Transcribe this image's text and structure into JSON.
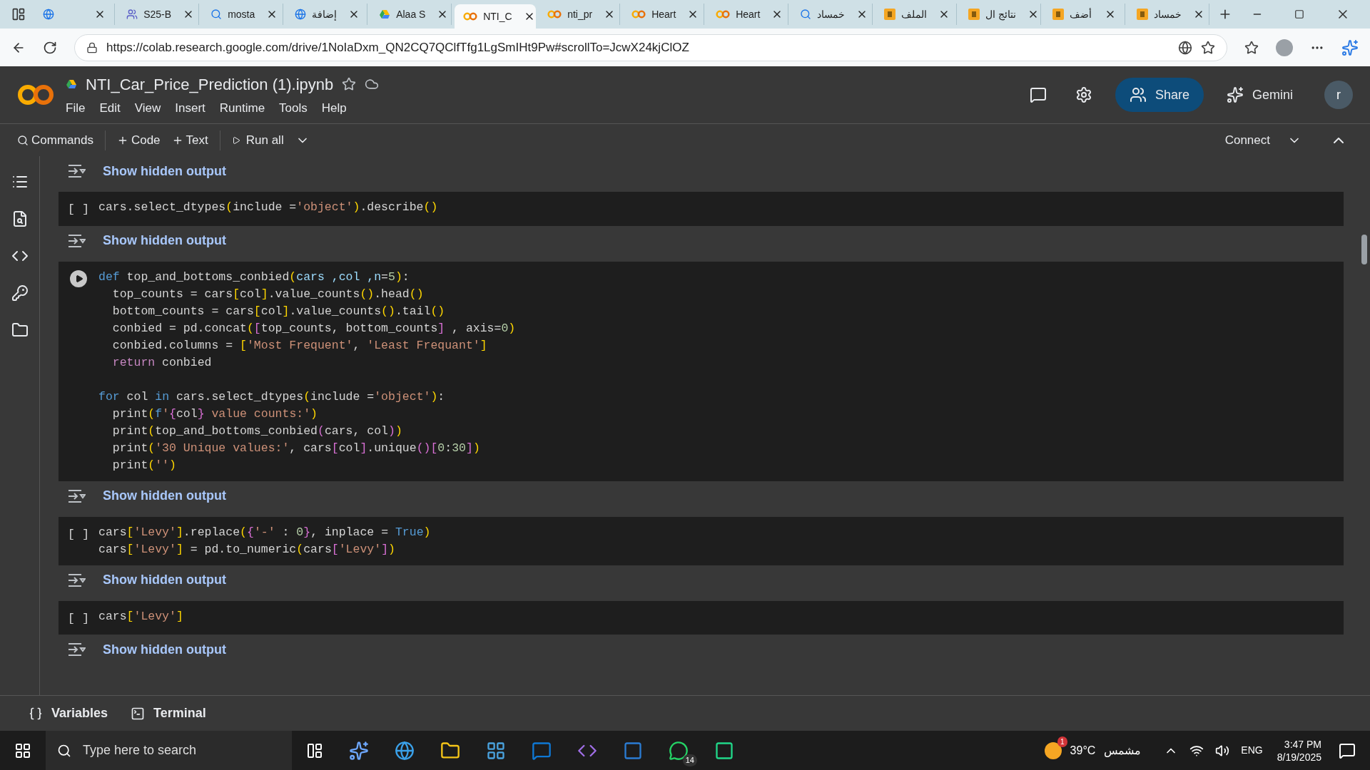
{
  "browser": {
    "tabs": [
      {
        "selected": false
      },
      {
        "title": "S25-B",
        "selected": false
      },
      {
        "title": "mosta",
        "selected": false
      },
      {
        "title": "إضافة",
        "selected": false
      },
      {
        "title": "Alaa S",
        "selected": false
      },
      {
        "title": "NTI_C",
        "selected": true
      },
      {
        "title": "nti_pr",
        "selected": false
      },
      {
        "title": "Heart",
        "selected": false
      },
      {
        "title": "Heart",
        "selected": false
      },
      {
        "title": "خمساد",
        "selected": false
      },
      {
        "title": "الملف",
        "selected": false
      },
      {
        "title": "نتائج ال",
        "selected": false
      },
      {
        "title": "أضف",
        "selected": false
      },
      {
        "title": "خمساد",
        "selected": false
      }
    ],
    "url": "https://colab.research.google.com/drive/1NoIaDxm_QN2CQ7QClfTfg1LgSmIHt9Pw#scrollTo=JcwX24kjClOZ"
  },
  "notebook": {
    "title": "NTI_Car_Price_Prediction (1).ipynb",
    "menu": [
      "File",
      "Edit",
      "View",
      "Insert",
      "Runtime",
      "Tools",
      "Help"
    ],
    "share": "Share",
    "gemini": "Gemini",
    "avatar": "r"
  },
  "toolbar": {
    "commands": "Commands",
    "add_code": "Code",
    "add_text": "Text",
    "run_all": "Run all",
    "connect": "Connect"
  },
  "cells": [
    {
      "kind": "output",
      "label": "Show hidden output"
    },
    {
      "kind": "code",
      "hovered": false,
      "prompt": "[ ]",
      "blocks": [
        [
          [
            {
              "kind": "p",
              "text": "cars.select_dtypes"
            },
            {
              "kind": "b1",
              "text": "("
            },
            {
              "kind": "p",
              "text": "include ="
            },
            {
              "kind": "s",
              "text": "'object'"
            },
            {
              "kind": "b1",
              "text": ")"
            },
            {
              "kind": "p",
              "text": ".describe"
            },
            {
              "kind": "b1",
              "text": "()"
            }
          ]
        ]
      ]
    },
    {
      "kind": "output",
      "label": "Show hidden output"
    },
    {
      "kind": "code",
      "hovered": true,
      "blocks": [
        [
          [
            {
              "kind": "k",
              "text": "def"
            },
            {
              "kind": "p",
              "text": " top_and_bottoms_conbied"
            },
            {
              "kind": "b1",
              "text": "("
            },
            {
              "kind": "v",
              "text": "cars ,col ,n"
            },
            {
              "kind": "p",
              "text": "="
            },
            {
              "kind": "n",
              "text": "5"
            },
            {
              "kind": "b1",
              "text": ")"
            },
            {
              "kind": "p",
              "text": ":"
            }
          ],
          [
            {
              "kind": "p",
              "text": "  top_counts = cars"
            },
            {
              "kind": "b1",
              "text": "["
            },
            {
              "kind": "p",
              "text": "col"
            },
            {
              "kind": "b1",
              "text": "]"
            },
            {
              "kind": "p",
              "text": ".value_counts"
            },
            {
              "kind": "b1",
              "text": "()"
            },
            {
              "kind": "p",
              "text": ".head"
            },
            {
              "kind": "b1",
              "text": "()"
            }
          ],
          [
            {
              "kind": "p",
              "text": "  bottom_counts = cars"
            },
            {
              "kind": "b1",
              "text": "["
            },
            {
              "kind": "p",
              "text": "col"
            },
            {
              "kind": "b1",
              "text": "]"
            },
            {
              "kind": "p",
              "text": ".value_counts"
            },
            {
              "kind": "b1",
              "text": "()"
            },
            {
              "kind": "p",
              "text": ".tail"
            },
            {
              "kind": "b1",
              "text": "()"
            }
          ],
          [
            {
              "kind": "p",
              "text": "  conbied = pd.concat"
            },
            {
              "kind": "b1",
              "text": "("
            },
            {
              "kind": "b2",
              "text": "["
            },
            {
              "kind": "p",
              "text": "top_counts, bottom_counts"
            },
            {
              "kind": "b2",
              "text": "]"
            },
            {
              "kind": "p",
              "text": " , axis="
            },
            {
              "kind": "n",
              "text": "0"
            },
            {
              "kind": "b1",
              "text": ")"
            }
          ],
          [
            {
              "kind": "p",
              "text": "  conbied.columns = "
            },
            {
              "kind": "b1",
              "text": "["
            },
            {
              "kind": "s",
              "text": "'Most Frequent'"
            },
            {
              "kind": "p",
              "text": ", "
            },
            {
              "kind": "s",
              "text": "'Least Frequant'"
            },
            {
              "kind": "b1",
              "text": "]"
            }
          ],
          [
            {
              "kind": "c",
              "text": "  return"
            },
            {
              "kind": "p",
              "text": " conbied"
            }
          ]
        ],
        [
          [
            {
              "kind": "k",
              "text": "for"
            },
            {
              "kind": "p",
              "text": " col "
            },
            {
              "kind": "k",
              "text": "in"
            },
            {
              "kind": "p",
              "text": " cars.select_dtypes"
            },
            {
              "kind": "b1",
              "text": "("
            },
            {
              "kind": "p",
              "text": "include ="
            },
            {
              "kind": "s",
              "text": "'object'"
            },
            {
              "kind": "b1",
              "text": ")"
            },
            {
              "kind": "p",
              "text": ":"
            }
          ],
          [
            {
              "kind": "p",
              "text": "  print"
            },
            {
              "kind": "b1",
              "text": "("
            },
            {
              "kind": "k",
              "text": "f"
            },
            {
              "kind": "s",
              "text": "'"
            },
            {
              "kind": "b2",
              "text": "{"
            },
            {
              "kind": "p",
              "text": "col"
            },
            {
              "kind": "b2",
              "text": "}"
            },
            {
              "kind": "s",
              "text": " value counts:'"
            },
            {
              "kind": "b1",
              "text": ")"
            }
          ],
          [
            {
              "kind": "p",
              "text": "  print"
            },
            {
              "kind": "b1",
              "text": "("
            },
            {
              "kind": "p",
              "text": "top_and_bottoms_conbied"
            },
            {
              "kind": "b2",
              "text": "("
            },
            {
              "kind": "p",
              "text": "cars, col"
            },
            {
              "kind": "b2",
              "text": ")"
            },
            {
              "kind": "b1",
              "text": ")"
            }
          ],
          [
            {
              "kind": "p",
              "text": "  print"
            },
            {
              "kind": "b1",
              "text": "("
            },
            {
              "kind": "s",
              "text": "'30 Unique values:'"
            },
            {
              "kind": "p",
              "text": ", cars"
            },
            {
              "kind": "b2",
              "text": "["
            },
            {
              "kind": "p",
              "text": "col"
            },
            {
              "kind": "b2",
              "text": "]"
            },
            {
              "kind": "p",
              "text": ".unique"
            },
            {
              "kind": "b2",
              "text": "()"
            },
            {
              "kind": "b2",
              "text": "["
            },
            {
              "kind": "n",
              "text": "0"
            },
            {
              "kind": "p",
              "text": ":"
            },
            {
              "kind": "n",
              "text": "30"
            },
            {
              "kind": "b2",
              "text": "]"
            },
            {
              "kind": "b1",
              "text": ")"
            }
          ],
          [
            {
              "kind": "p",
              "text": "  print"
            },
            {
              "kind": "b1",
              "text": "("
            },
            {
              "kind": "s",
              "text": "''"
            },
            {
              "kind": "b1",
              "text": ")"
            }
          ]
        ]
      ]
    },
    {
      "kind": "output",
      "label": "Show hidden output"
    },
    {
      "kind": "code",
      "hovered": false,
      "prompt": "[ ]",
      "blocks": [
        [
          [
            {
              "kind": "p",
              "text": "cars"
            },
            {
              "kind": "b1",
              "text": "["
            },
            {
              "kind": "s",
              "text": "'Levy'"
            },
            {
              "kind": "b1",
              "text": "]"
            },
            {
              "kind": "p",
              "text": ".replace"
            },
            {
              "kind": "b1",
              "text": "("
            },
            {
              "kind": "b2",
              "text": "{"
            },
            {
              "kind": "s",
              "text": "'-'"
            },
            {
              "kind": "p",
              "text": " : "
            },
            {
              "kind": "n",
              "text": "0"
            },
            {
              "kind": "b2",
              "text": "}"
            },
            {
              "kind": "p",
              "text": ", inplace = "
            },
            {
              "kind": "k",
              "text": "True"
            },
            {
              "kind": "b1",
              "text": ")"
            }
          ],
          [
            {
              "kind": "p",
              "text": "cars"
            },
            {
              "kind": "b1",
              "text": "["
            },
            {
              "kind": "s",
              "text": "'Levy'"
            },
            {
              "kind": "b1",
              "text": "]"
            },
            {
              "kind": "p",
              "text": " = pd.to_numeric"
            },
            {
              "kind": "b1",
              "text": "("
            },
            {
              "kind": "p",
              "text": "cars"
            },
            {
              "kind": "b2",
              "text": "["
            },
            {
              "kind": "s",
              "text": "'Levy'"
            },
            {
              "kind": "b2",
              "text": "]"
            },
            {
              "kind": "b1",
              "text": ")"
            }
          ]
        ]
      ]
    },
    {
      "kind": "output",
      "label": "Show hidden output"
    },
    {
      "kind": "code",
      "hovered": false,
      "prompt": "[ ]",
      "blocks": [
        [
          [
            {
              "kind": "p",
              "text": "cars"
            },
            {
              "kind": "b1",
              "text": "["
            },
            {
              "kind": "s",
              "text": "'Levy'"
            },
            {
              "kind": "b1",
              "text": "]"
            }
          ]
        ]
      ]
    },
    {
      "kind": "output",
      "label": "Show hidden output"
    }
  ],
  "bottom_bar": {
    "variables": "Variables",
    "terminal": "Terminal"
  },
  "taskbar": {
    "search_placeholder": "Type here to search",
    "whatsapp_badge": "14",
    "weather_badge": "1",
    "temperature": "39°C",
    "weather": "مشمس",
    "language": "ENG",
    "time": "3:47 PM",
    "date": "8/19/2025"
  }
}
